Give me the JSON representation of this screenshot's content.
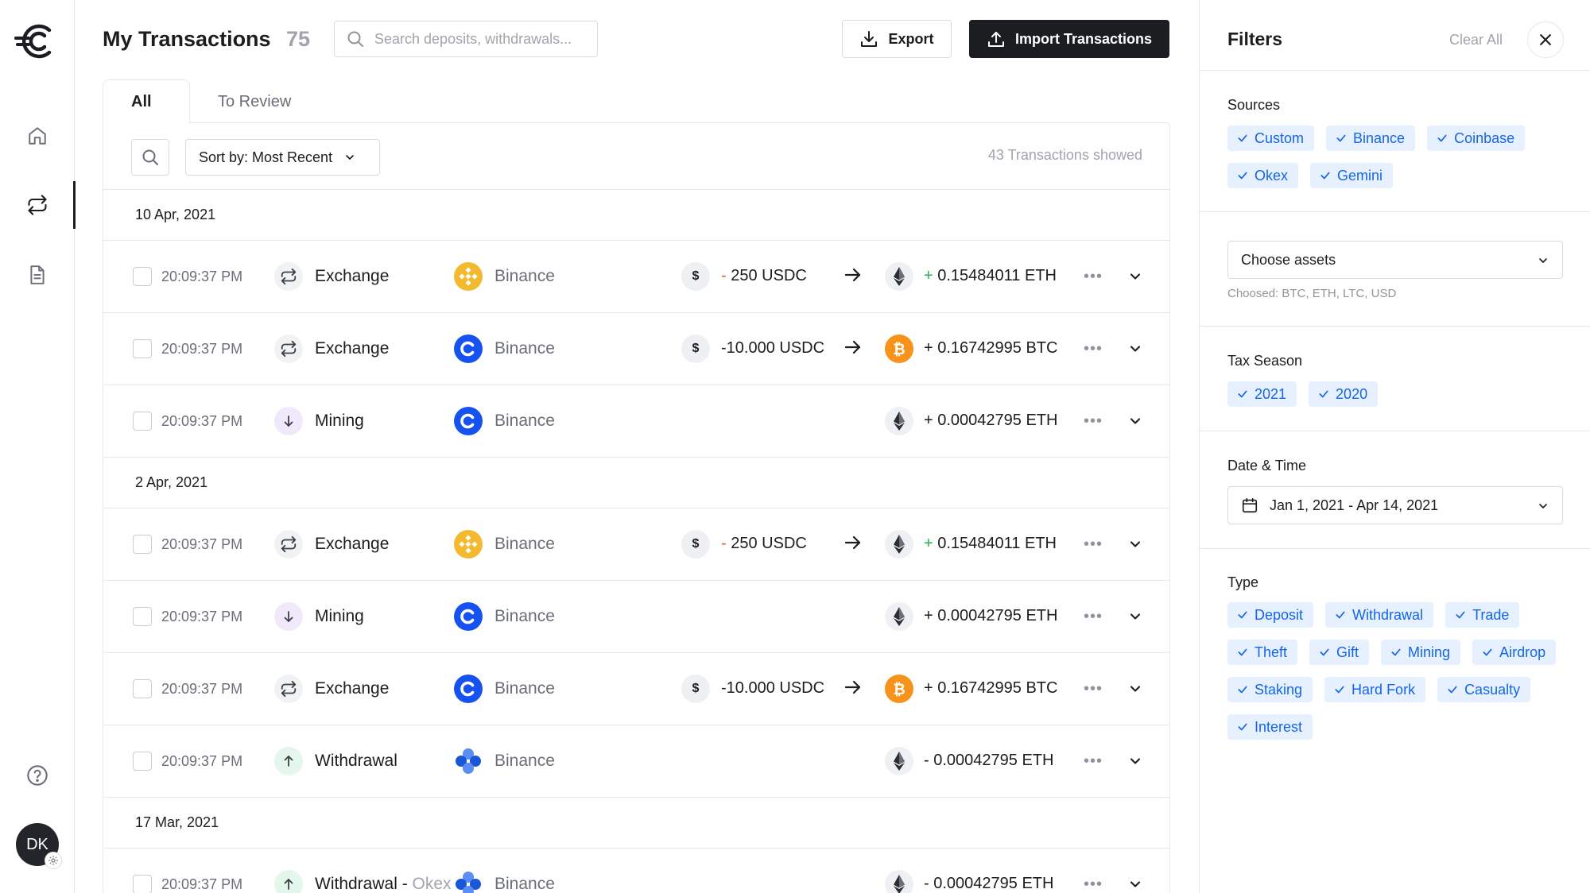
{
  "header": {
    "title": "My Transactions",
    "count": "75",
    "search_placeholder": "Search deposits, withdrawals...",
    "export_label": "Export",
    "import_label": "Import Transactions"
  },
  "sidebar": {
    "avatar_initials": "DK",
    "nav": [
      {
        "icon": "home-icon"
      },
      {
        "icon": "transactions-icon",
        "active": true
      },
      {
        "icon": "document-icon"
      }
    ]
  },
  "tabs": [
    {
      "label": "All",
      "active": true
    },
    {
      "label": "To Review"
    }
  ],
  "toolbar": {
    "sort_label": "Sort by: Most Recent",
    "shown_text": "43 Transactions showed"
  },
  "groups": [
    {
      "date": "10 Apr, 2021",
      "rows": [
        {
          "time": "20:09:37 PM",
          "type": "Exchange",
          "type_icon": "exchange-icon",
          "source": "Binance",
          "source_icon": "binance-icon",
          "out_sign": "-",
          "out_amount": " 250 USDC",
          "in_sign": "+",
          "in_amount": " 0.15484011 ETH",
          "asset_icon": "eth-icon"
        },
        {
          "time": "20:09:37 PM",
          "type": "Exchange",
          "type_icon": "exchange-icon",
          "source": "Binance",
          "source_icon": "coinbase-icon",
          "out_sign": "",
          "out_amount": "-10.000 USDC",
          "in_sign": "",
          "in_amount": "+ 0.16742995 BTC",
          "asset_icon": "btc-icon"
        },
        {
          "time": "20:09:37 PM",
          "type": "Mining",
          "type_icon": "mining-icon",
          "source": "Binance",
          "source_icon": "coinbase-icon",
          "out_sign": "",
          "out_amount": "",
          "in_sign": "",
          "in_amount": "+ 0.00042795 ETH",
          "asset_icon": "eth-icon"
        }
      ]
    },
    {
      "date": "2 Apr, 2021",
      "rows": [
        {
          "time": "20:09:37 PM",
          "type": "Exchange",
          "type_icon": "exchange-icon",
          "source": "Binance",
          "source_icon": "binance-icon",
          "out_sign": "-",
          "out_amount": " 250 USDC",
          "in_sign": "+",
          "in_amount": " 0.15484011 ETH",
          "asset_icon": "eth-icon"
        },
        {
          "time": "20:09:37 PM",
          "type": "Mining",
          "type_icon": "mining-icon",
          "source": "Binance",
          "source_icon": "coinbase-icon",
          "out_sign": "",
          "out_amount": "",
          "in_sign": "",
          "in_amount": "+ 0.00042795 ETH",
          "asset_icon": "eth-icon"
        },
        {
          "time": "20:09:37 PM",
          "type": "Exchange",
          "type_icon": "exchange-icon",
          "source": "Binance",
          "source_icon": "coinbase-icon",
          "out_sign": "",
          "out_amount": "-10.000 USDC",
          "in_sign": "",
          "in_amount": "+ 0.16742995 BTC",
          "asset_icon": "btc-icon"
        },
        {
          "time": "20:09:37 PM",
          "type": "Withdrawal",
          "type_icon": "withdrawal-icon",
          "source": "Binance",
          "source_icon": "blue-dots-icon",
          "out_sign": "",
          "out_amount": "",
          "in_sign": "",
          "in_amount": "- 0.00042795 ETH",
          "asset_icon": "eth-icon"
        }
      ]
    },
    {
      "date": "17 Mar, 2021",
      "rows": [
        {
          "time": "20:09:37 PM",
          "type": "Withdrawal - ",
          "type_muted": "Okex",
          "type_icon": "withdrawal-icon",
          "source": "Binance",
          "source_icon": "blue-dots-icon",
          "out_sign": "",
          "out_amount": "",
          "in_sign": "",
          "in_amount": "- 0.00042795 ETH",
          "asset_icon": "eth-icon"
        }
      ]
    }
  ],
  "filters": {
    "title": "Filters",
    "clear_all": "Clear All",
    "sources_label": "Sources",
    "sources": [
      "Custom",
      "Binance",
      "Coinbase",
      "Okex",
      "Gemini"
    ],
    "assets_select": "Choose assets",
    "assets_hint": "Choosed: BTC, ETH, LTC, USD",
    "tax_label": "Tax Season",
    "tax": [
      "2021",
      "2020"
    ],
    "date_label": "Date & Time",
    "date_range": "Jan 1, 2021 - Apr 14, 2021",
    "type_label": "Type",
    "types": [
      "Deposit",
      "Withdrawal",
      "Trade",
      "Theft",
      "Gift",
      "Mining",
      "Airdrop",
      "Staking",
      "Hard Fork",
      "Casualty",
      "Interest"
    ]
  },
  "colors": {
    "accent": "#1466e8",
    "chip_bg": "#e7f0fe",
    "positive": "#22b35a",
    "negative": "#e8572a",
    "dark": "#1c1d21"
  }
}
